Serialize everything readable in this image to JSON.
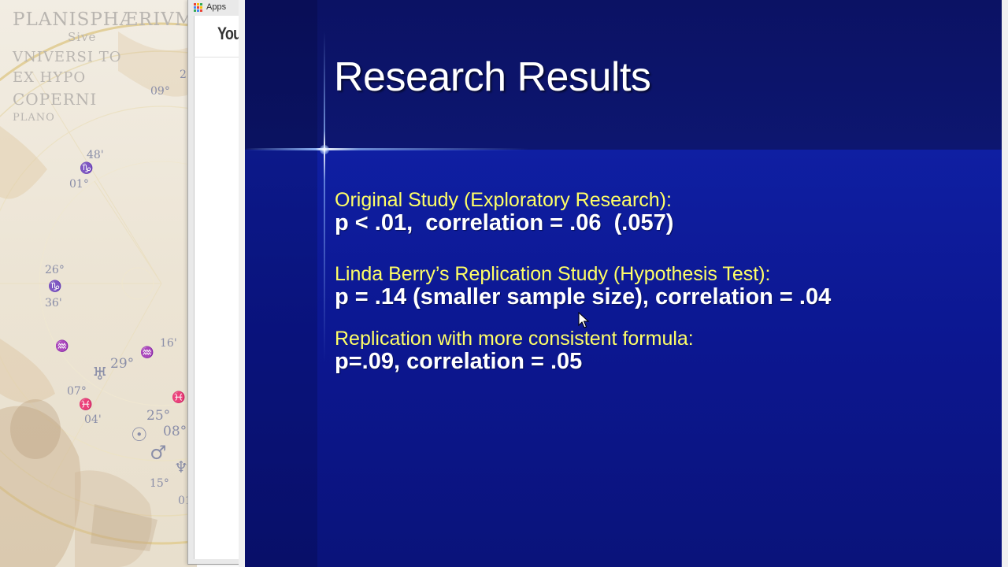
{
  "wallpaper": {
    "lines": [
      "PLANISPHÆRIVM",
      "Sive",
      "VNIVERSI TO",
      "EX HYPO",
      "COPERNI",
      "PLANO"
    ],
    "degree_marks": [
      "09°",
      "2",
      "48'",
      "01°",
      "26°",
      "36'",
      "16'",
      "29°",
      "07°",
      "04'",
      "25°",
      "08°",
      "15°",
      "01"
    ],
    "symbols": [
      "♑",
      "♑",
      "♒",
      "♒",
      "♅",
      "♓",
      "♓",
      "☉",
      "♂",
      "♆"
    ]
  },
  "browser": {
    "bookmark_apps": "Apps",
    "page_logo": "You",
    "apps_icon_colors": [
      "#e94235",
      "#fbbc05",
      "#34a853",
      "#4285f4",
      "#e94235",
      "#fbbc05",
      "#34a853",
      "#4285f4",
      "#e94235"
    ]
  },
  "slide": {
    "title": "Research Results",
    "blocks": [
      {
        "label": "Original Study (Exploratory Research):",
        "value": "p < .01,  correlation = .06  (.057)"
      },
      {
        "label": "Linda Berry’s Replication Study (Hypothesis Test):",
        "value": "p = .14 (smaller sample size), correlation = .04"
      },
      {
        "label": "Replication with more consistent formula:",
        "value": "p=.09, correlation = .05"
      }
    ],
    "colors": {
      "label": "#ffff66",
      "value": "#ffffff",
      "background": "#0c1791"
    }
  },
  "cursor": {
    "icon": "arrow-pointer-icon"
  }
}
